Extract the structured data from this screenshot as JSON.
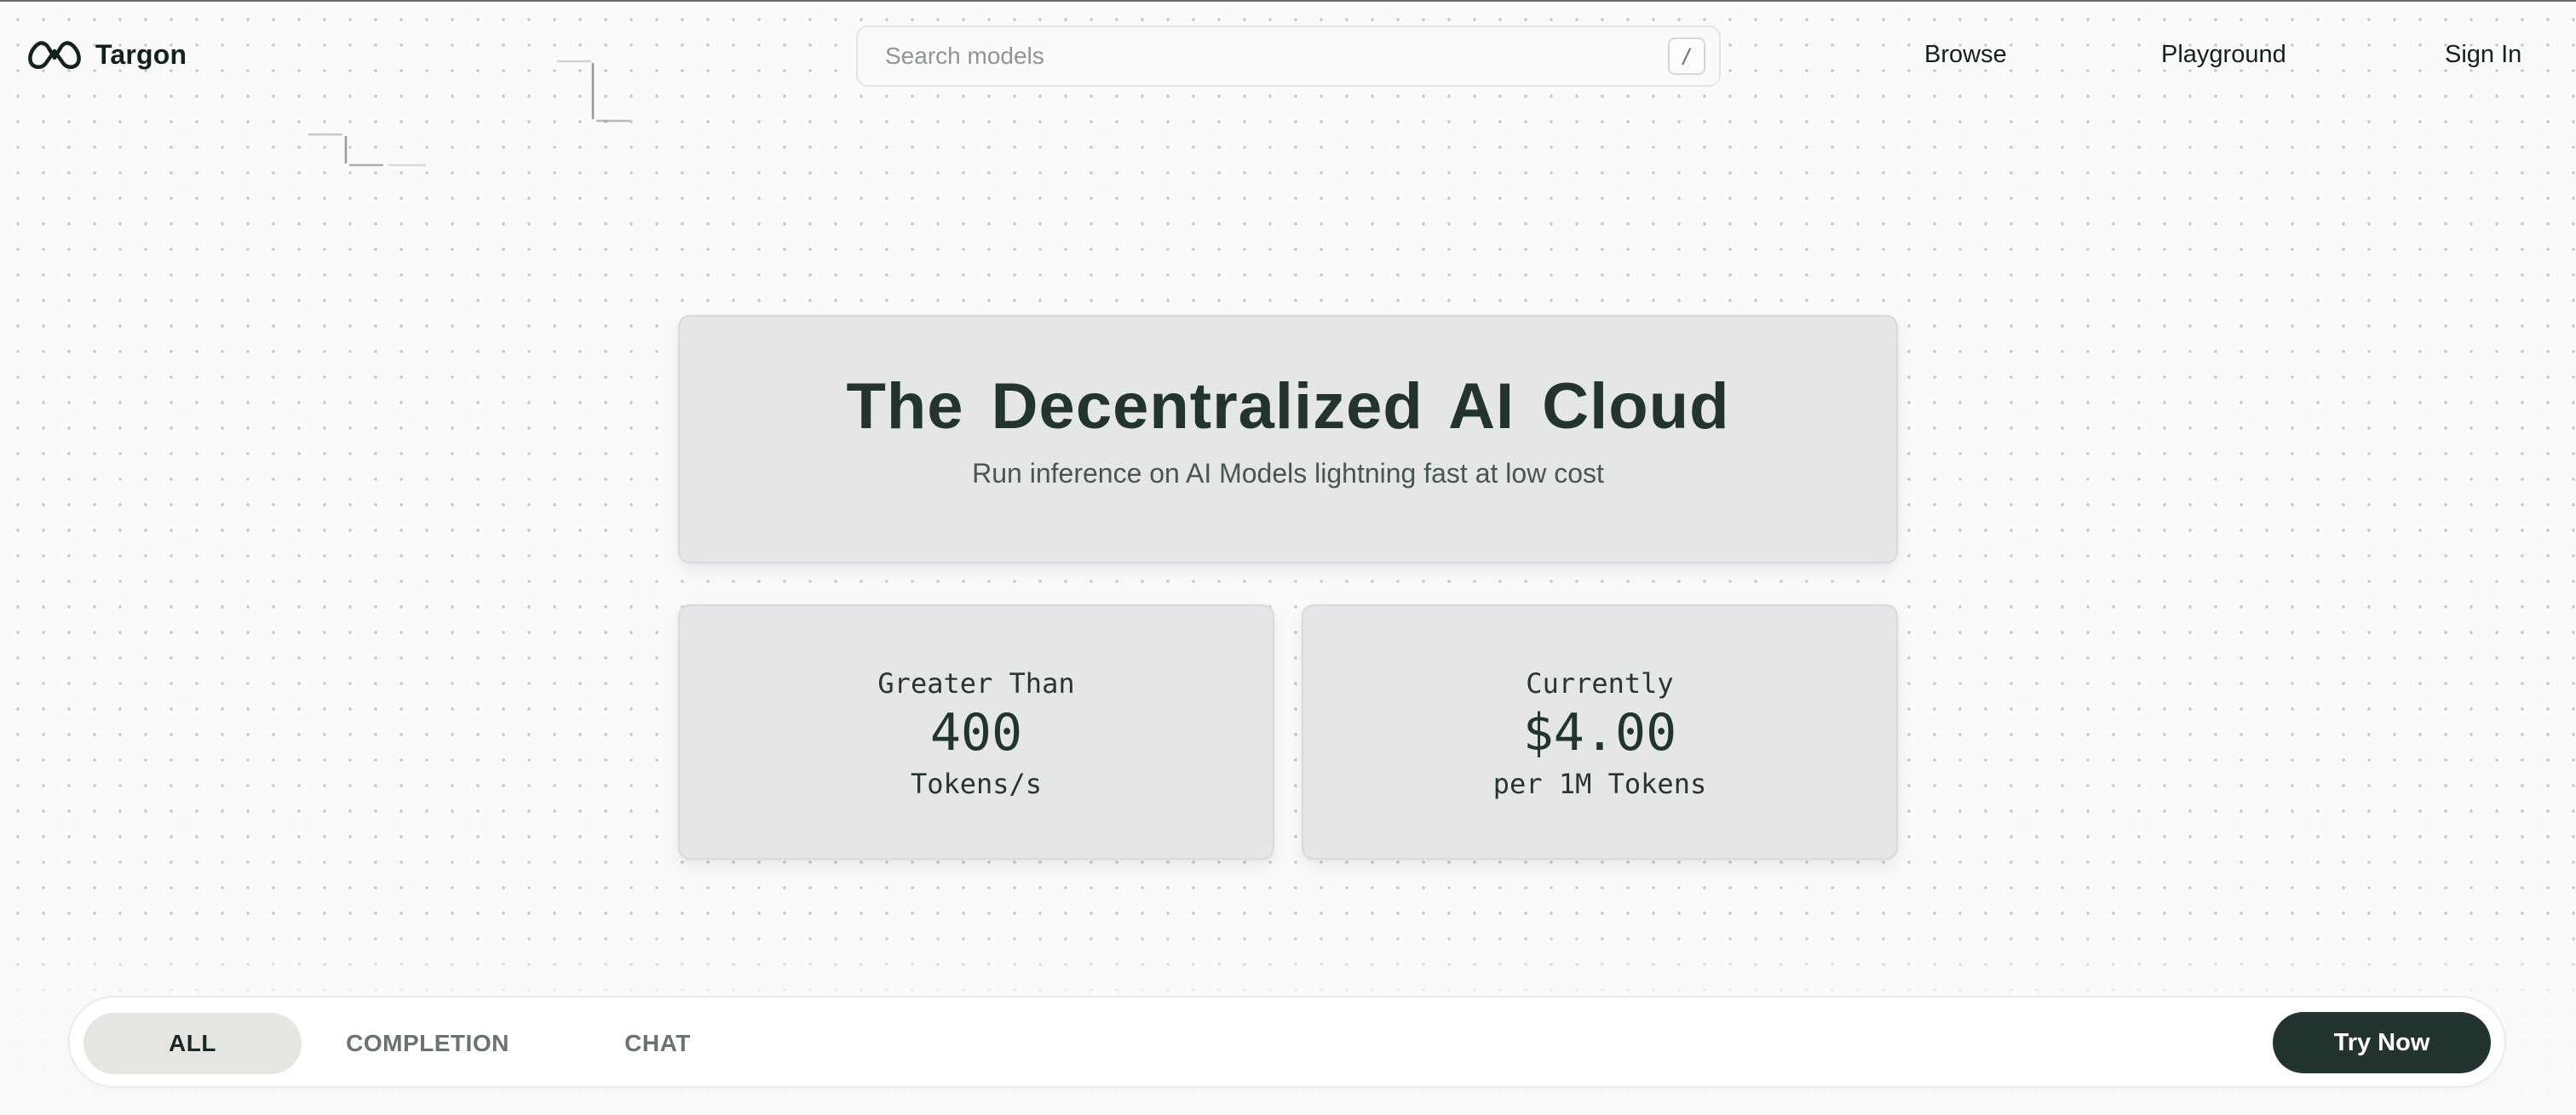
{
  "header": {
    "brand": "Targon",
    "logo_icon": "targon-infinity-logo",
    "search": {
      "placeholder": "Search models",
      "value": "",
      "shortcut": "/"
    },
    "nav": [
      "Browse",
      "Playground",
      "Sign In"
    ]
  },
  "hero": {
    "title": "The Decentralized AI Cloud",
    "subtitle": "Run inference on AI Models lightning fast at low cost"
  },
  "stats": [
    {
      "pre": "Greater Than",
      "value": "400",
      "post": "Tokens/s"
    },
    {
      "pre": "Currently",
      "value": "$4.00",
      "post": "per 1M Tokens"
    }
  ],
  "filters": {
    "tabs": [
      "ALL",
      "COMPLETION",
      "CHAT"
    ],
    "active": "ALL",
    "cta": "Try Now"
  },
  "colors": {
    "brand_dark": "#223330",
    "card_bg": "#e5e6e8",
    "page_bg": "#fafafa"
  }
}
